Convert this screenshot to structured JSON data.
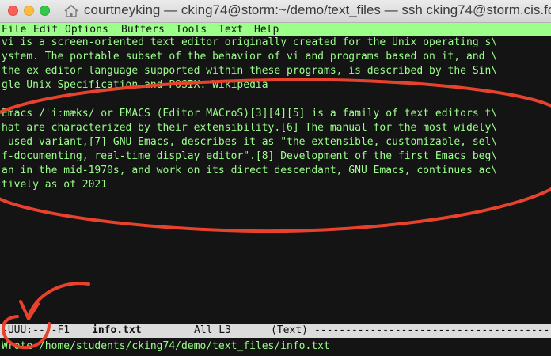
{
  "window": {
    "title": "courtneyking — cking74@storm:~/demo/text_files — ssh cking74@storm.cis.fo…"
  },
  "menu": [
    "File",
    "Edit",
    "Options",
    "Buffers",
    "Tools",
    "Text",
    "Help"
  ],
  "buffer_lines": [
    "vi is a screen-oriented text editor originally created for the Unix operating s\\",
    "ystem. The portable subset of the behavior of vi and programs based on it, and \\",
    "the ex editor language supported within these programs, is described by the Sin\\",
    "gle Unix Specification and POSIX. Wikipedia",
    "",
    "Emacs /ˈiːmæks/ or EMACS (Editor MACroS)[3][4][5] is a family of text editors t\\",
    "hat are characterized by their extensibility.[6] The manual for the most widely\\",
    " used variant,[7] GNU Emacs, describes it as \"the extensible, customizable, sel\\",
    "f-documenting, real-time display editor\".[8] Development of the first Emacs beg\\",
    "an in the mid-1970s, and work on its direct descendant, GNU Emacs, continues ac\\",
    "tively as of 2021"
  ],
  "modeline": {
    "status": "-UUU:----F1",
    "buffer_name": "info.txt",
    "position": "All L3",
    "mode": "(Text)",
    "fill": "-----------------------------------------------------"
  },
  "echo_area": "Wrote /home/students/cking74/demo/text_files/info.txt",
  "colors": {
    "terminal_fg": "#9bff8a",
    "terminal_bg": "#141414",
    "annotation": "#e8422c"
  }
}
